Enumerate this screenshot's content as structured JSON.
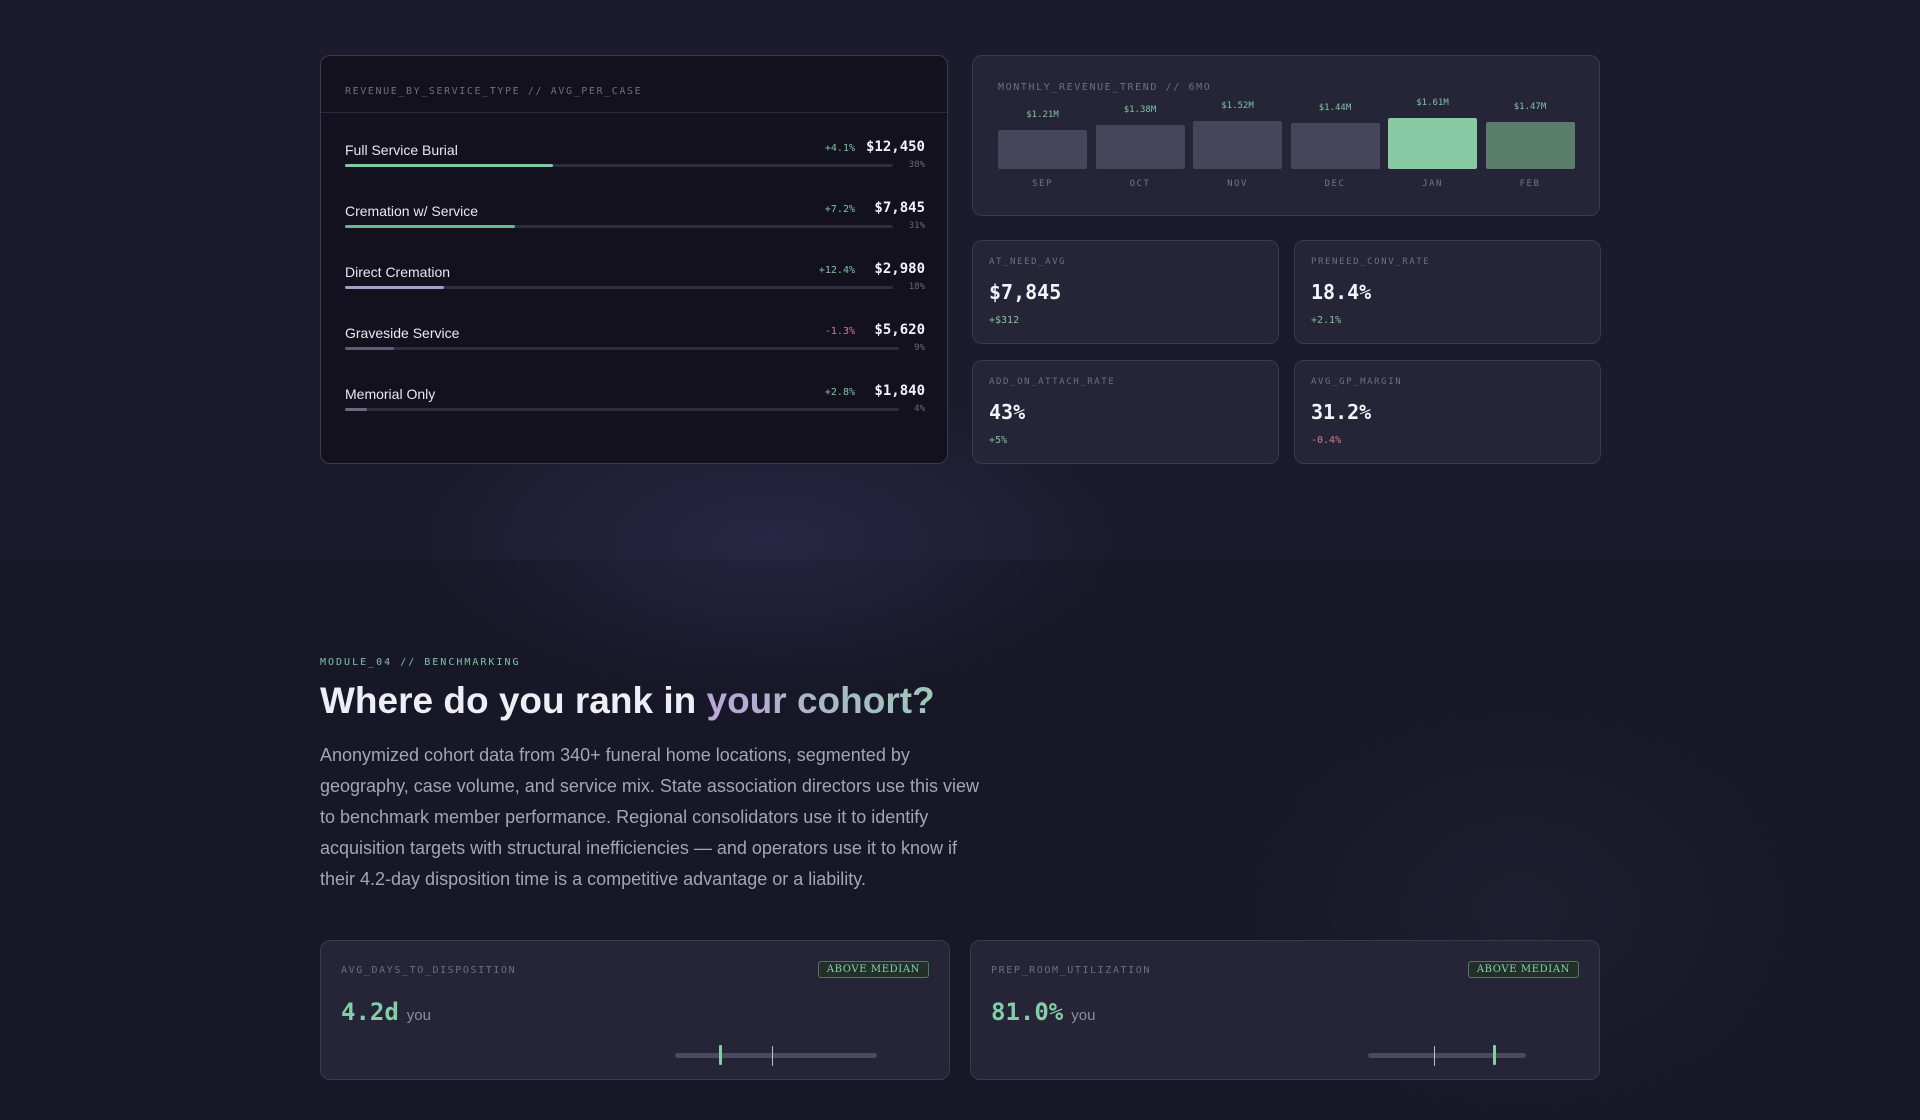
{
  "services_card": {
    "caption": "REVENUE_BY_SERVICE_TYPE // AVG_PER_CASE",
    "rows": [
      {
        "name": "Full Service Burial",
        "change": "+4.1%",
        "price": "$12,450",
        "pct": "38%",
        "share": 0.38,
        "color": "#7fc8a0",
        "change_color": "#7fc3a3"
      },
      {
        "name": "Cremation w/ Service",
        "change": "+7.2%",
        "price": "$7,845",
        "pct": "31%",
        "share": 0.31,
        "color": "#6fb394",
        "change_color": "#7fc3a3"
      },
      {
        "name": "Direct Cremation",
        "change": "+12.4%",
        "price": "$2,980",
        "pct": "18%",
        "share": 0.18,
        "color": "#a99bd0",
        "change_color": "#7fc3a3"
      },
      {
        "name": "Graveside Service",
        "change": "-1.3%",
        "price": "$5,620",
        "pct": "9%",
        "share": 0.09,
        "color": "#5e5d72",
        "change_color": "#d9788f"
      },
      {
        "name": "Memorial Only",
        "change": "+2.8%",
        "price": "$1,840",
        "pct": "4%",
        "share": 0.04,
        "color": "#6a697e",
        "change_color": "#7fc3a3"
      }
    ]
  },
  "trend_card": {
    "caption": "MONTHLY_REVENUE_TREND // 6MO"
  },
  "chart_data": {
    "type": "bar",
    "categories": [
      "SEP",
      "OCT",
      "NOV",
      "DEC",
      "JAN",
      "FEB"
    ],
    "values": [
      1.21,
      1.38,
      1.52,
      1.44,
      1.61,
      1.47
    ],
    "value_labels": [
      "$1.21M",
      "$1.38M",
      "$1.52M",
      "$1.44M",
      "$1.61M",
      "$1.47M"
    ],
    "ylabel": "",
    "xlabel": "",
    "colors": [
      "#46455b",
      "#46455b",
      "#46455b",
      "#46455b",
      "#86c9a2",
      "#5a7d6c"
    ],
    "grid": false
  },
  "kpis": [
    {
      "label": "AT_NEED_AVG",
      "value": "$7,845",
      "delta": "+$312",
      "delta_color": "#7fc3a3"
    },
    {
      "label": "PRENEED_CONV_RATE",
      "value": "18.4%",
      "delta": "+2.1%",
      "delta_color": "#7fc3a3"
    },
    {
      "label": "ADD_ON_ATTACH_RATE",
      "value": "43%",
      "delta": "+5%",
      "delta_color": "#7fc3a3"
    },
    {
      "label": "AVG_GP_MARGIN",
      "value": "31.2%",
      "delta": "-0.4%",
      "delta_color": "#d9788f"
    }
  ],
  "module": {
    "tag": "MODULE_04 // BENCHMARKING",
    "title_main": "Where do you rank in ",
    "title_accent": "your cohort?",
    "description": "Anonymized cohort data from 340+ funeral home locations, segmented by geography, case volume, and service mix. State association directors use this view to benchmark member performance. Regional consolidators use it to identify acquisition targets with structural inefficiencies — and operators use it to know if their 4.2-day disposition time is a competitive advantage or a liability."
  },
  "benchmarks": [
    {
      "label": "AVG_DAYS_TO_DISPOSITION",
      "badge": "ABOVE MEDIAN",
      "value": "4.2d",
      "you_label": "you",
      "you_pos": 0.18,
      "median_pos": 0.48
    },
    {
      "label": "PREP_ROOM_UTILIZATION",
      "badge": "ABOVE MEDIAN",
      "value": "81.0%",
      "you_label": "you",
      "you_pos": 0.74,
      "median_pos": 0.42
    }
  ]
}
